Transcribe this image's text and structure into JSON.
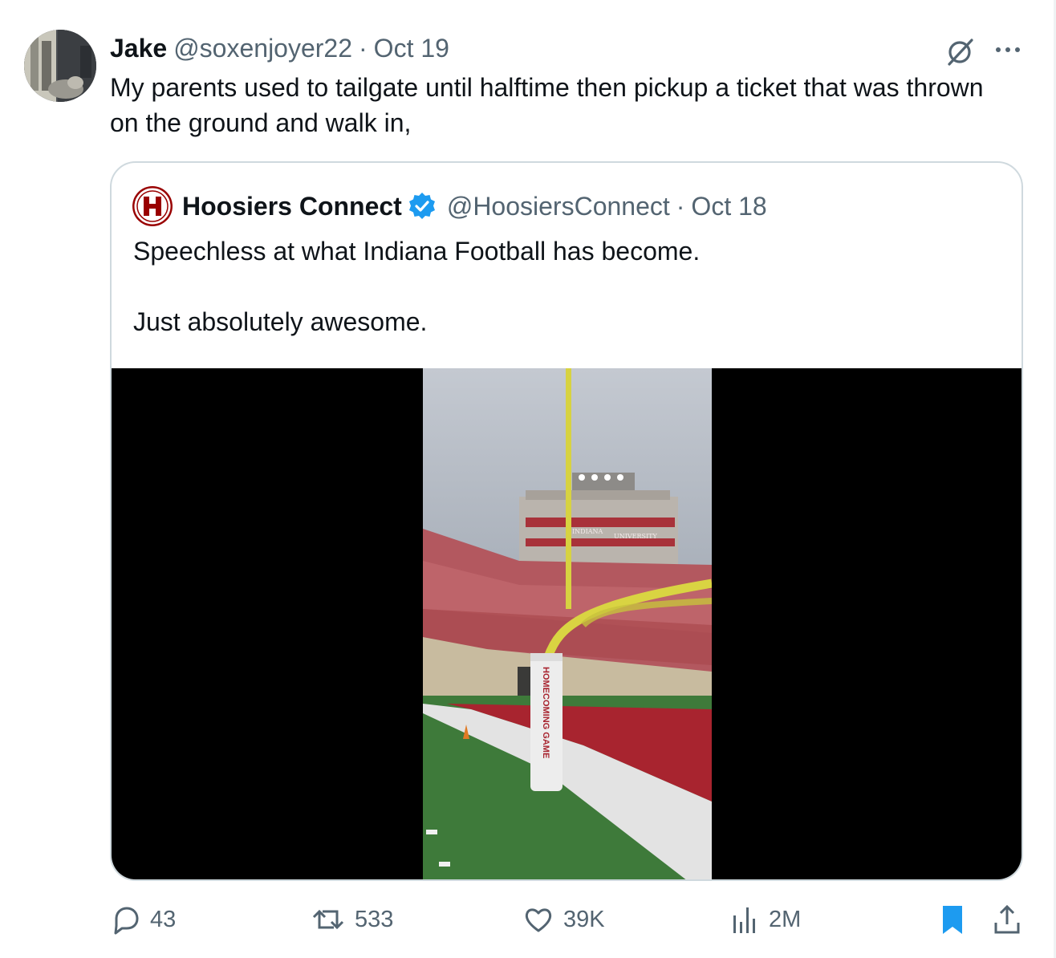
{
  "author": {
    "name": "Jake",
    "handle": "@soxenjoyer22",
    "separator": "·",
    "date": "Oct 19",
    "avatar_icon": "user-avatar-photo"
  },
  "tweet": {
    "text": "My parents used to tailgate until halftime then pickup a ticket that was thrown on the ground and walk in,"
  },
  "header_actions": {
    "grok_icon": "grok-icon",
    "more_icon": "more-options-icon"
  },
  "quoted": {
    "name": "Hoosiers Connect",
    "handle": "@HoosiersConnect",
    "separator": "·",
    "date": "Oct 18",
    "verified_icon": "verified-badge-icon",
    "verified_color": "#1d9bf0",
    "paragraphs": [
      "Speechless at what Indiana Football has become.",
      "Just absolutely awesome."
    ],
    "media": {
      "goalpost_text": "HOMECOMING GAME",
      "pressbox_text_1": "INDIANA",
      "pressbox_text_2": "UNIVERSITY"
    }
  },
  "actions": {
    "reply_count": "43",
    "repost_count": "533",
    "like_count": "39K",
    "view_count": "2M",
    "bookmark_color": "#1d9bf0",
    "icon_color": "#536471"
  },
  "colors": {
    "brand": "#1d9bf0",
    "text": "#0f1419",
    "secondary": "#536471",
    "border": "#cfd9de",
    "hoosiers_crimson": "#990000"
  }
}
